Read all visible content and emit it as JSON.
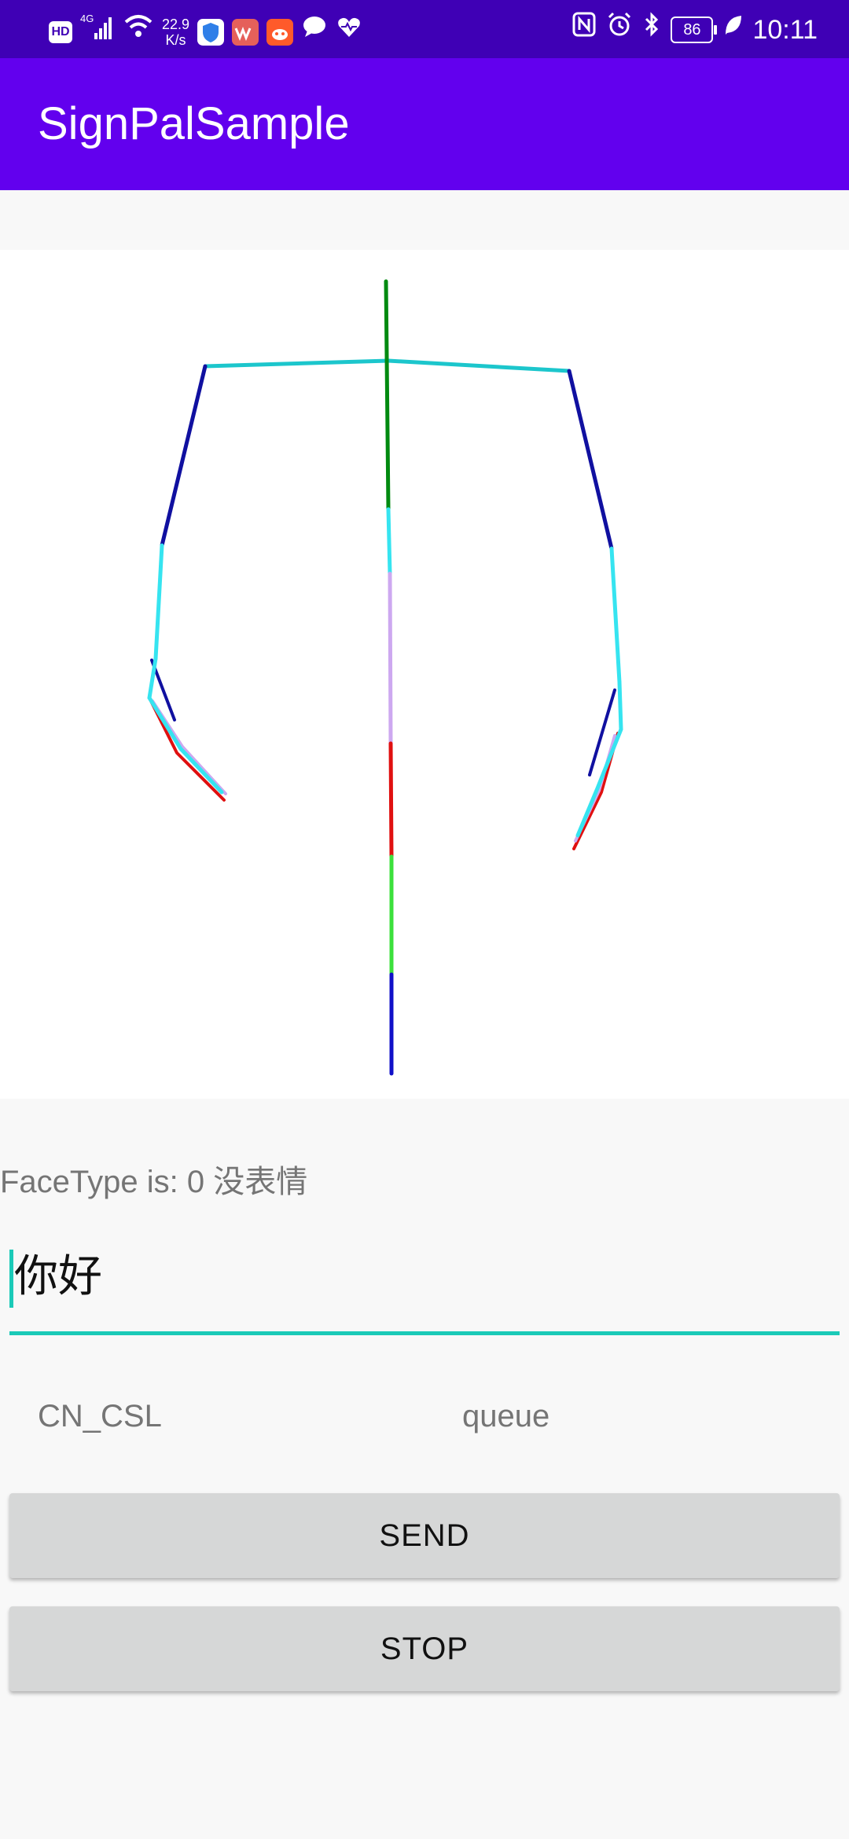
{
  "status_bar": {
    "hd_badge": "HD",
    "network": "4G",
    "speed_value": "22.9",
    "speed_unit": "K/s",
    "battery": "86",
    "time": "10:11"
  },
  "app_bar": {
    "title": "SignPalSample"
  },
  "pose_view": {
    "colors": {
      "shoulders": "#1cc6cc",
      "upper_arms": "#1010a0",
      "forearms": "#36e4f0",
      "spine_top": "#008a10",
      "spine_lavender": "#cda8f0",
      "spine_red": "#e01010",
      "spine_green": "#3ce03c",
      "spine_blue": "#1010c8"
    }
  },
  "face_type_text": "FaceType is: 0 没表情",
  "input": {
    "value": "你好"
  },
  "options": {
    "language": "CN_CSL",
    "mode": "queue"
  },
  "buttons": {
    "send": "SEND",
    "stop": "STOP"
  }
}
